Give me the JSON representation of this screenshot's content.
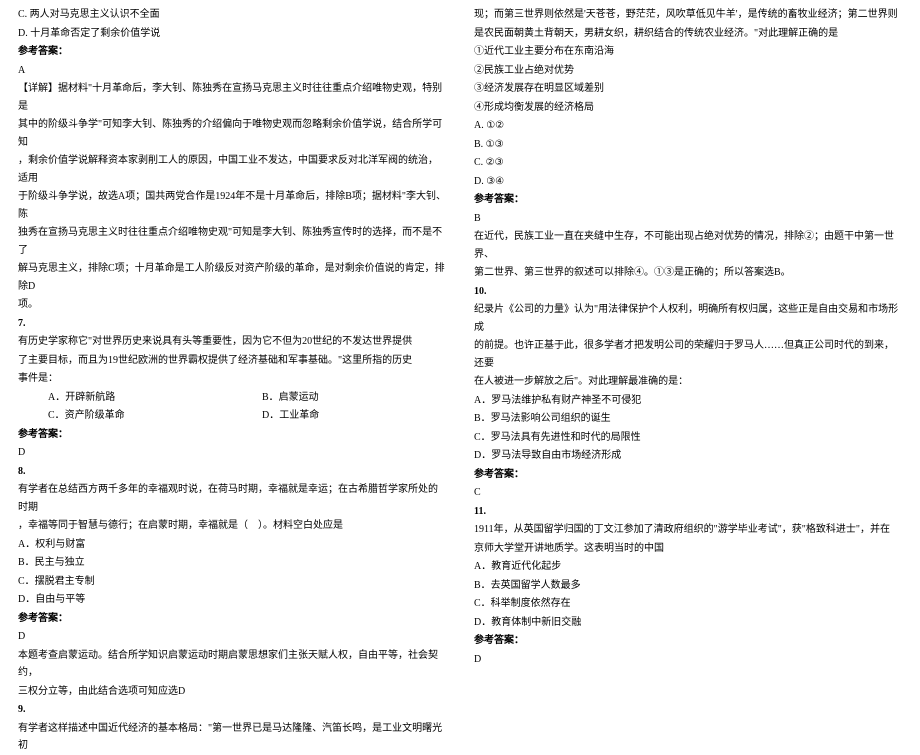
{
  "left": {
    "l1": "C. 两人对马克思主义认识不全面",
    "l2": "D. 十月革命否定了剩余价值学说",
    "ans_label": "参考答案：",
    "ans1": "A",
    "exp1a": "【详解】据材料\"十月革命后，李大钊、陈独秀在宣扬马克思主义时往往重点介绍唯物史观，特别是",
    "exp1b": "其中的阶级斗争学\"可知李大钊、陈独秀的介绍偏向于唯物史观而忽略剩余价值学说，结合所学可知",
    "exp1c": "，剩余价值学说解释资本家剥削工人的原因，中国工业不发达，中国要求反对北洋军阀的统治，适用",
    "exp1d": "于阶级斗争学说，故选A项；国共两党合作是1924年不是十月革命后，排除B项；据材料\"李大钊、陈",
    "exp1e": "独秀在宣扬马克思主义时往往重点介绍唯物史观\"可知是李大钊、陈独秀宣传时的选择，而不是不了",
    "exp1f": "解马克思主义，排除C项；十月革命是工人阶级反对资产阶级的革命，是对剩余价值说的肯定，排除D",
    "exp1g": "项。",
    "q7_num": "7.",
    "q7a": "有历史学家称它\"对世界历史来说具有头等重要性，因为它不但为20世纪的不发达世界提供",
    "q7b": "了主要目标，而且为19世纪欧洲的世界霸权提供了经济基础和军事基础。\"这里所指的历史",
    "q7c": "事件是：",
    "q7_a": "A．开辟新航路",
    "q7_b": "B．启蒙运动",
    "q7_c": "C．资产阶级革命",
    "q7_d": "D．工业革命",
    "ans7": "D",
    "q8_num": "8.",
    "q8a": "有学者在总结西方两千多年的幸福观时说，在荷马时期，幸福就是幸运；在古希腊哲学家所处的时期",
    "q8b": "，幸福等同于智慧与德行；在启蒙时期，幸福就是（　）。材料空白处应是",
    "q8_a": "A．权利与财富",
    "q8_b": "B．民主与独立",
    "q8_c": "C．摆脱君主专制",
    "q8_d": "D．自由与平等",
    "ans8": "D",
    "exp8a": "本题考查启蒙运动。结合所学知识启蒙运动时期启蒙思想家们主张天赋人权，自由平等，社会契约，",
    "exp8b": "三权分立等，由此结合选项可知应选D",
    "q9_num": "9.",
    "q9a": "有学者这样描述中国近代经济的基本格局：\"第一世界已是马达隆隆、汽笛长鸣，是工业文明曙光初"
  },
  "right": {
    "r1": "现；而第三世界则依然是'天苍苍，野茫茫，风吹草低见牛羊'，是传统的畜牧业经济；第二世界则",
    "r2": "是农民面朝黄土背朝天，男耕女织，耕织结合的传统农业经济。\"对此理解正确的是",
    "r3": "①近代工业主要分布在东南沿海",
    "r4": "②民族工业占绝对优势",
    "r5": "③经济发展存在明显区域差别",
    "r6": "④形成均衡发展的经济格局",
    "r7": "A. ①②",
    "r8": "B. ①③",
    "r9": "C. ②③",
    "r10": "D. ③④",
    "ans_label": "参考答案：",
    "ans9": "B",
    "exp9a": "在近代，民族工业一直在夹缝中生存，不可能出现占绝对优势的情况，排除②；由题干中第一世界、",
    "exp9b": "第二世界、第三世界的叙述可以排除④。①③是正确的；所以答案选B。",
    "q10_num": "10.",
    "q10a": "纪录片《公司的力量》认为\"用法律保护个人权利，明确所有权归属，这些正是自由交易和市场形成",
    "q10b": "的前提。也许正基于此，很多学者才把发明公司的荣耀归于罗马人……但真正公司时代的到来，还要",
    "q10c": "在人被进一步解放之后\"。对此理解最准确的是：",
    "q10_a": "A．罗马法维护私有财产神圣不可侵犯",
    "q10_b": "B．罗马法影响公司组织的诞生",
    "q10_c": "C．罗马法具有先进性和时代的局限性",
    "q10_d": "D．罗马法导致自由市场经济形成",
    "ans10": "C",
    "q11_num": "11.",
    "q11a": "1911年，从英国留学归国的丁文江参加了清政府组织的\"游学毕业考试\"，获\"格致科进士\"，并在",
    "q11b": "京师大学堂开讲地质学。这表明当时的中国",
    "q11_a": "A．教育近代化起步",
    "q11_b": "B．去英国留学人数最多",
    "q11_c": "C．科举制度依然存在",
    "q11_d": "D．教育体制中新旧交融",
    "ans11": "D"
  }
}
